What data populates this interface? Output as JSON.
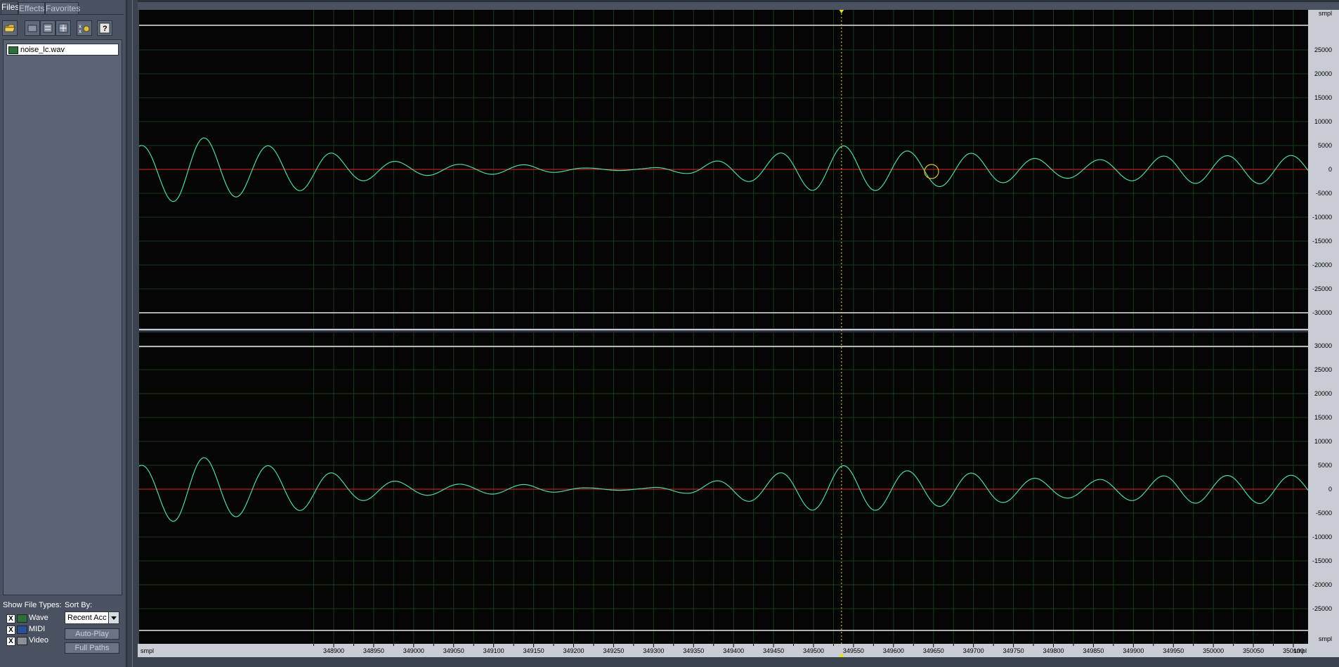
{
  "left_panel": {
    "tabs": [
      "Files",
      "Effects",
      "Favorites"
    ],
    "active_tab": "Files",
    "toolbar_icons": [
      "open-folder-icon",
      "close-file-icon",
      "insert-icon",
      "mix-icon",
      "settings-icon",
      "help-icon"
    ],
    "files": [
      "noise_lc.wav"
    ],
    "show_file_types_label": "Show File Types:",
    "sort_by_label": "Sort By:",
    "file_types": [
      {
        "label": "Wave",
        "checked": true,
        "mark": "X"
      },
      {
        "label": "MIDI",
        "checked": true,
        "mark": "X"
      },
      {
        "label": "Video",
        "checked": true,
        "mark": "X"
      }
    ],
    "sort_value": "Recent Acc",
    "auto_play_label": "Auto-Play",
    "full_paths_label": "Full Paths"
  },
  "editor": {
    "unit_label": "smpl",
    "x_ticks": [
      348900,
      348950,
      349000,
      349050,
      349100,
      349150,
      349200,
      349250,
      349300,
      349350,
      349400,
      349450,
      349500,
      349550,
      349600,
      349650,
      349700,
      349750,
      349800,
      349850,
      349900,
      349950,
      350000,
      350050,
      350100
    ],
    "y_ticks": [
      25000,
      20000,
      15000,
      10000,
      5000,
      0,
      -5000,
      -10000,
      -15000,
      -20000,
      -25000,
      -30000
    ],
    "y_ticks_bottom": [
      30000,
      25000,
      20000,
      15000,
      10000,
      5000,
      0,
      -5000,
      -10000,
      -15000,
      -20000,
      -25000
    ],
    "cursor_position": 349535,
    "colors": {
      "background": "#050505",
      "grid": "#1a3a1a",
      "waveform": "#4fd9a0",
      "center_line": "#b02020",
      "cursor": "#e8e020",
      "ruler_bg": "#c8ccd4"
    }
  }
}
